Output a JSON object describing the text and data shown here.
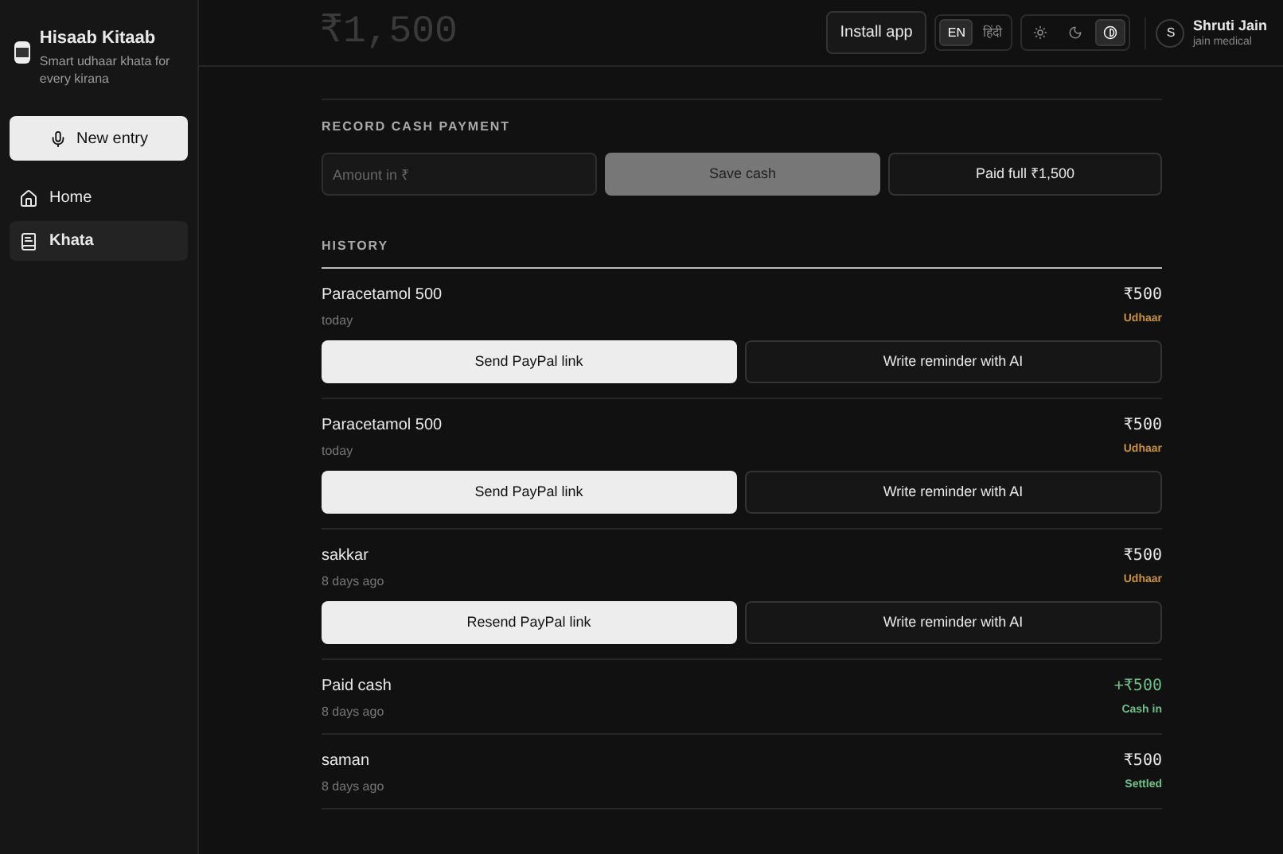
{
  "sidebar": {
    "app_name": "Hisaab Kitaab",
    "tagline": "Smart udhaar khata for every kirana",
    "new_entry": "New entry",
    "items": [
      {
        "label": "Home",
        "kind": "home",
        "selected": false
      },
      {
        "label": "Khata",
        "kind": "book",
        "selected": true
      }
    ]
  },
  "header": {
    "total": "₹1,500",
    "install": "Install app",
    "languages": [
      {
        "label": "EN",
        "selected": true
      },
      {
        "label": "हिंदी",
        "selected": false
      }
    ],
    "themes": [
      {
        "kind": "sun",
        "selected": false
      },
      {
        "kind": "moon",
        "selected": false
      },
      {
        "kind": "contrast",
        "selected": true
      }
    ],
    "user": {
      "initial": "S",
      "name": "Shruti Jain",
      "shop": "jain medical"
    }
  },
  "cash_payment": {
    "heading": "RECORD CASH PAYMENT",
    "placeholder": "Amount in ₹",
    "save": "Save cash",
    "paid_full": "Paid full ₹1,500"
  },
  "history": {
    "heading": "HISTORY",
    "entries": [
      {
        "kind": "udhaar",
        "name": "Paracetamol 500",
        "time": "today",
        "amount": "₹500",
        "status": "Udhaar",
        "buttons": [
          "Send PayPal link",
          "Write reminder with AI"
        ]
      },
      {
        "kind": "udhaar",
        "name": "Paracetamol 500",
        "time": "today",
        "amount": "₹500",
        "status": "Udhaar",
        "buttons": [
          "Send PayPal link",
          "Write reminder with AI"
        ]
      },
      {
        "kind": "udhaar",
        "name": "sakkar",
        "time": "8 days ago",
        "amount": "₹500",
        "status": "Udhaar",
        "buttons": [
          "Resend PayPal link",
          "Write reminder with AI"
        ]
      },
      {
        "kind": "cash_in",
        "name": "Paid cash",
        "time": "8 days ago",
        "amount": "+₹500",
        "status": "Cash in"
      },
      {
        "kind": "settled",
        "name": "saman",
        "time": "8 days ago",
        "amount": "₹500",
        "status": "Settled"
      }
    ]
  }
}
